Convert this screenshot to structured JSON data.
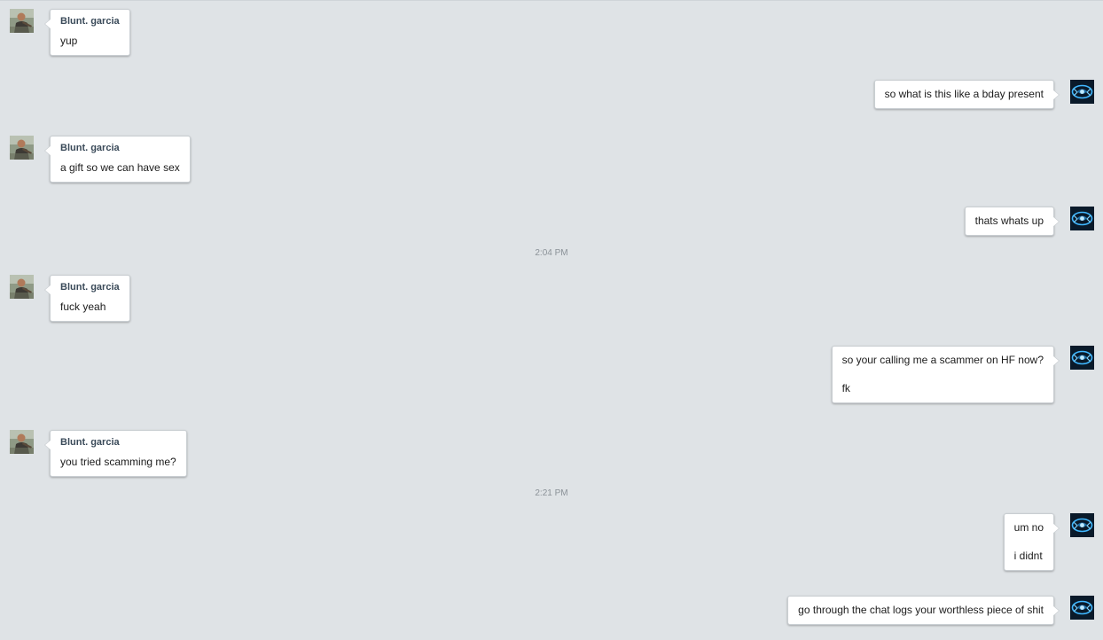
{
  "conversation": {
    "other_user": {
      "name": "Blunt. garcia"
    },
    "messages": [
      {
        "side": "left",
        "sender": "Blunt. garcia",
        "lines": [
          "yup"
        ]
      },
      {
        "side": "right",
        "lines": [
          "so what is this like a bday present"
        ]
      },
      {
        "side": "left",
        "sender": "Blunt. garcia",
        "lines": [
          "a gift so we can have sex"
        ]
      },
      {
        "side": "right",
        "lines": [
          "thats whats up"
        ]
      },
      {
        "side": "left",
        "sender": "Blunt. garcia",
        "lines": [
          "fuck yeah"
        ]
      },
      {
        "side": "right",
        "lines": [
          "so your calling me a scammer on HF now?",
          "fk"
        ]
      },
      {
        "side": "left",
        "sender": "Blunt. garcia",
        "lines": [
          "you tried scamming me?"
        ]
      },
      {
        "side": "right",
        "lines": [
          "um no",
          "i didnt"
        ]
      },
      {
        "side": "right",
        "lines": [
          "go through the chat logs your worthless piece of shit"
        ]
      }
    ],
    "timestamps": [
      "2:04 PM",
      "2:21 PM"
    ]
  },
  "theme": {
    "background": "#dfe3e6",
    "bubble": "#ffffff",
    "bubble_border": "#c9ced2",
    "sender_color": "#3a4a59",
    "timestamp_color": "#8b9298"
  },
  "icons": {
    "other_avatar": "user-photo-avatar",
    "self_avatar": "blue-glow-avatar"
  }
}
